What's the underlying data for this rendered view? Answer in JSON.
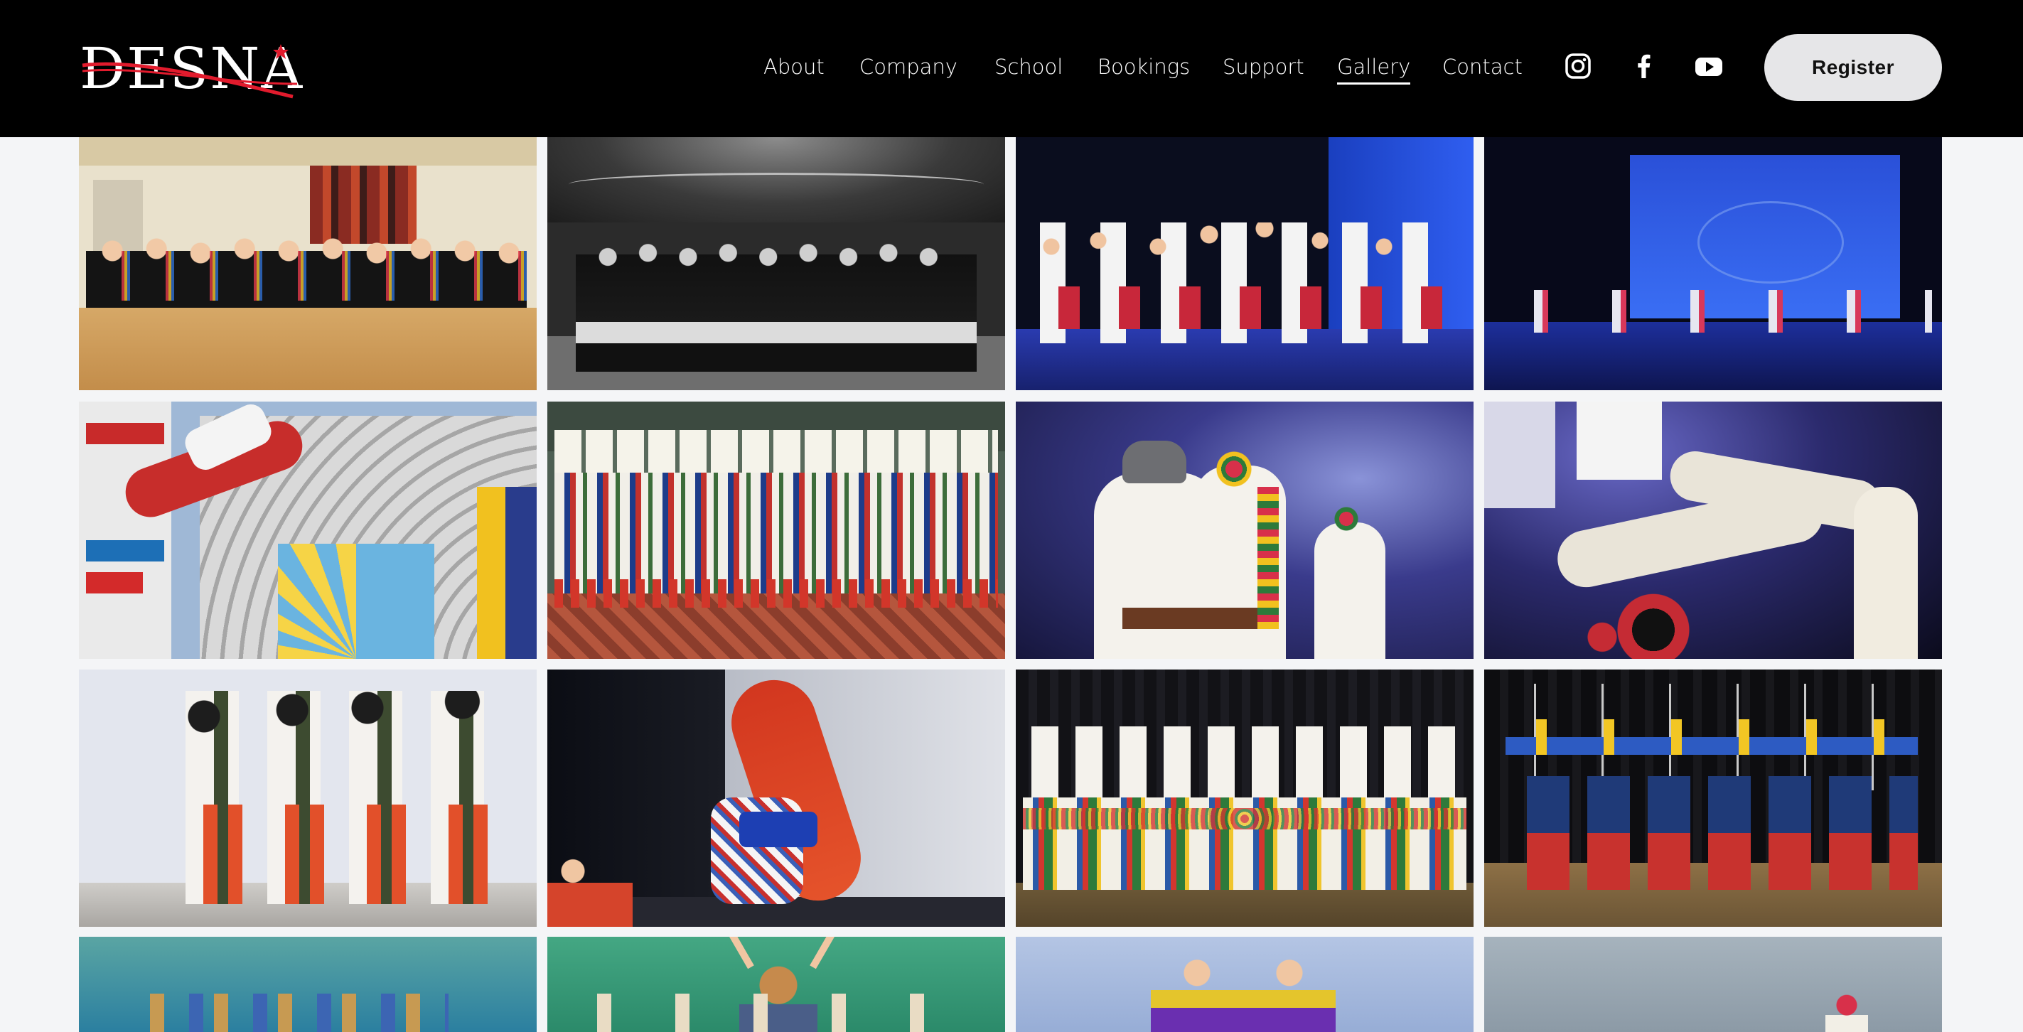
{
  "brand": {
    "logo_text": "DESNA",
    "accent": "#e21b2d"
  },
  "nav": {
    "items": [
      {
        "label": "About",
        "active": false
      },
      {
        "label": "Company",
        "active": false
      },
      {
        "label": "School",
        "active": false
      },
      {
        "label": "Bookings",
        "active": false
      },
      {
        "label": "Support",
        "active": false
      },
      {
        "label": "Gallery",
        "active": true
      },
      {
        "label": "Contact",
        "active": false
      }
    ],
    "social": [
      "instagram-icon",
      "facebook-icon",
      "youtube-icon"
    ],
    "register_label": "Register"
  },
  "gallery": {
    "photos": [
      {
        "name": "group-rehearsal-studio"
      },
      {
        "name": "group-black-and-white-stage"
      },
      {
        "name": "women-dancers-blue-stage"
      },
      {
        "name": "stage-blue-screen-company-logo"
      },
      {
        "name": "male-dancer-leap-bandshell"
      },
      {
        "name": "ensemble-costume-portrait"
      },
      {
        "name": "couple-dance-concert-stage"
      },
      {
        "name": "male-dancers-acrobatics-stage"
      },
      {
        "name": "boys-hopak-line-white-stage"
      },
      {
        "name": "dancer-handstand-red-pants"
      },
      {
        "name": "women-ensemble-black-backdrop"
      },
      {
        "name": "men-with-flags-poles"
      },
      {
        "name": "dancers-hats-teal-stage"
      },
      {
        "name": "dancer-arms-raised-green-stage"
      },
      {
        "name": "children-dancers-blue-stage"
      },
      {
        "name": "dancer-grey-backdrop"
      }
    ]
  }
}
